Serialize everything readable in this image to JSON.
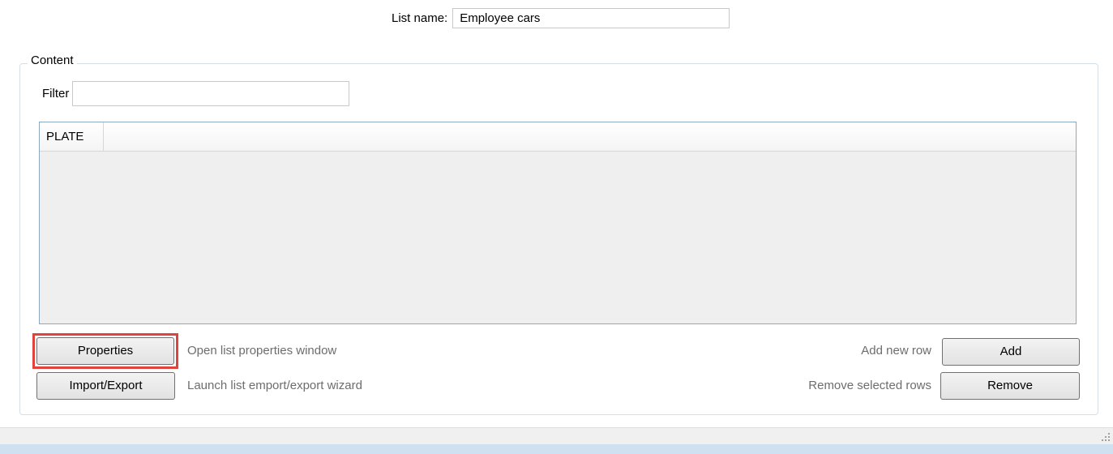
{
  "list_name": {
    "label": "List name:",
    "value": "Employee cars"
  },
  "content_group": {
    "title": "Content",
    "filter_label": "Filter",
    "filter_value": ""
  },
  "grid": {
    "columns": [
      "PLATE"
    ],
    "rows": []
  },
  "actions": {
    "properties_label": "Properties",
    "properties_hint": "Open list properties window",
    "import_export_label": "Import/Export",
    "import_export_hint": "Launch list emport/export wizard",
    "add_label": "Add",
    "add_hint": "Add new row",
    "remove_label": "Remove",
    "remove_hint": "Remove selected rows"
  },
  "colors": {
    "highlight": "#e0423c",
    "grid_border": "#8ea8c2",
    "bottom_bar": "#cfe0f1"
  },
  "icons": {
    "resize_grip": "resize-grip-icon"
  }
}
